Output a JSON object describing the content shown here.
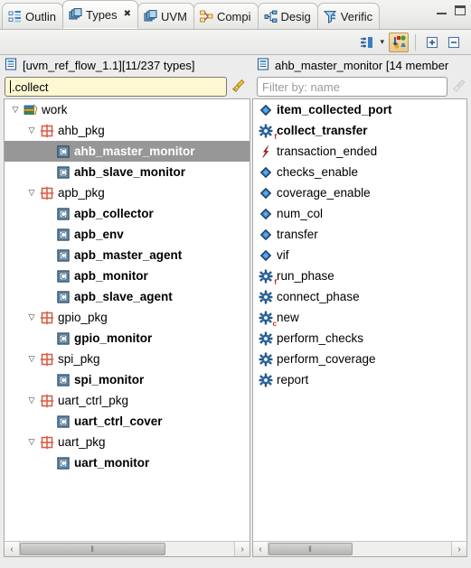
{
  "window": {
    "minimize_label": "Minimize",
    "maximize_label": "Maximize"
  },
  "tabs": [
    {
      "label": "Outlin",
      "icon": "outline-icon",
      "active": false,
      "closable": false
    },
    {
      "label": "Types",
      "icon": "types-icon",
      "active": true,
      "closable": true
    },
    {
      "label": "UVM",
      "icon": "uvm-icon",
      "active": false,
      "closable": false
    },
    {
      "label": "Compi",
      "icon": "compile-icon",
      "active": false,
      "closable": false
    },
    {
      "label": "Desig",
      "icon": "design-icon",
      "active": false,
      "closable": false
    },
    {
      "label": "Verific",
      "icon": "verify-icon",
      "active": false,
      "closable": false
    }
  ],
  "toolbar": {
    "sort_label": "Sort / filter options",
    "menu_caret": "▾",
    "show_members_label": "Show members",
    "expand_all_label": "Expand All",
    "collapse_all_label": "Collapse All"
  },
  "left_panel": {
    "title": "[uvm_ref_flow_1.1][11/237 types]",
    "title_icon": "library-icon",
    "filter_value": ".collect",
    "filter_placeholder": "Filter by: name",
    "clear_filter_label": "Clear filter",
    "tree": [
      {
        "label": "work",
        "indent": 0,
        "twisty": "▽",
        "icon": "library-books-icon",
        "bold": false,
        "selected": false
      },
      {
        "label": "ahb_pkg",
        "indent": 1,
        "twisty": "▽",
        "icon": "package-icon",
        "bold": false,
        "selected": false
      },
      {
        "label": "ahb_master_monitor",
        "indent": 2,
        "twisty": "",
        "icon": "class-icon",
        "bold": true,
        "selected": true
      },
      {
        "label": "ahb_slave_monitor",
        "indent": 2,
        "twisty": "",
        "icon": "class-icon",
        "bold": true,
        "selected": false
      },
      {
        "label": "apb_pkg",
        "indent": 1,
        "twisty": "▽",
        "icon": "package-icon",
        "bold": false,
        "selected": false
      },
      {
        "label": "apb_collector",
        "indent": 2,
        "twisty": "",
        "icon": "class-icon",
        "bold": true,
        "selected": false
      },
      {
        "label": "apb_env",
        "indent": 2,
        "twisty": "",
        "icon": "class-icon",
        "bold": true,
        "selected": false
      },
      {
        "label": "apb_master_agent",
        "indent": 2,
        "twisty": "",
        "icon": "class-icon",
        "bold": true,
        "selected": false
      },
      {
        "label": "apb_monitor",
        "indent": 2,
        "twisty": "",
        "icon": "class-icon",
        "bold": true,
        "selected": false
      },
      {
        "label": "apb_slave_agent",
        "indent": 2,
        "twisty": "",
        "icon": "class-icon",
        "bold": true,
        "selected": false
      },
      {
        "label": "gpio_pkg",
        "indent": 1,
        "twisty": "▽",
        "icon": "package-icon",
        "bold": false,
        "selected": false
      },
      {
        "label": "gpio_monitor",
        "indent": 2,
        "twisty": "",
        "icon": "class-icon",
        "bold": true,
        "selected": false
      },
      {
        "label": "spi_pkg",
        "indent": 1,
        "twisty": "▽",
        "icon": "package-icon",
        "bold": false,
        "selected": false
      },
      {
        "label": "spi_monitor",
        "indent": 2,
        "twisty": "",
        "icon": "class-icon",
        "bold": true,
        "selected": false
      },
      {
        "label": "uart_ctrl_pkg",
        "indent": 1,
        "twisty": "▽",
        "icon": "package-icon",
        "bold": false,
        "selected": false
      },
      {
        "label": "uart_ctrl_cover",
        "indent": 2,
        "twisty": "",
        "icon": "class-icon",
        "bold": true,
        "selected": false
      },
      {
        "label": "uart_pkg",
        "indent": 1,
        "twisty": "▽",
        "icon": "package-icon",
        "bold": false,
        "selected": false
      },
      {
        "label": "uart_monitor",
        "indent": 2,
        "twisty": "",
        "icon": "class-icon",
        "bold": true,
        "selected": false
      }
    ],
    "hscroll": {
      "left_arrow": "‹",
      "right_arrow": "›",
      "grip": "‖",
      "thumb_percent": 68,
      "thumb_offset_percent": 0
    }
  },
  "right_panel": {
    "title": "ahb_master_monitor [14 member",
    "title_icon": "library-icon",
    "filter_value": "",
    "filter_placeholder": "Filter by: name",
    "clear_filter_label": "Clear filter",
    "members": [
      {
        "label": "item_collected_port",
        "icon": "variable-icon",
        "bold": true,
        "badge": ""
      },
      {
        "label": "collect_transfer",
        "icon": "method-icon",
        "bold": true,
        "badge": "f"
      },
      {
        "label": "transaction_ended",
        "icon": "event-icon",
        "bold": false,
        "badge": ""
      },
      {
        "label": "checks_enable",
        "icon": "variable-icon",
        "bold": false,
        "badge": ""
      },
      {
        "label": "coverage_enable",
        "icon": "variable-icon",
        "bold": false,
        "badge": ""
      },
      {
        "label": "num_col",
        "icon": "variable-icon",
        "bold": false,
        "badge": ""
      },
      {
        "label": "transfer",
        "icon": "variable-icon",
        "bold": false,
        "badge": ""
      },
      {
        "label": "vif",
        "icon": "variable-icon",
        "bold": false,
        "badge": ""
      },
      {
        "label": "run_phase",
        "icon": "method-icon",
        "bold": false,
        "badge": "f"
      },
      {
        "label": "connect_phase",
        "icon": "method-icon",
        "bold": false,
        "badge": ""
      },
      {
        "label": "new",
        "icon": "method-icon",
        "bold": false,
        "badge": "c"
      },
      {
        "label": "perform_checks",
        "icon": "method-icon",
        "bold": false,
        "badge": ""
      },
      {
        "label": "perform_coverage",
        "icon": "method-icon",
        "bold": false,
        "badge": ""
      },
      {
        "label": "report",
        "icon": "method-icon",
        "bold": false,
        "badge": ""
      }
    ],
    "hscroll": {
      "left_arrow": "‹",
      "right_arrow": "›",
      "grip": "‖",
      "thumb_percent": 46,
      "thumb_offset_percent": 0
    }
  },
  "colors": {
    "selection_bg": "#979797",
    "selection_fg": "#ffffff",
    "filter_focus_bg": "#fdf7d2",
    "package_icon": "#d9604a",
    "class_icon": "#3b86c6",
    "member_icon": "#2f6fb5",
    "event_icon": "#cc1f1f",
    "toolbar_toggle_bg": "#e9c88a"
  }
}
